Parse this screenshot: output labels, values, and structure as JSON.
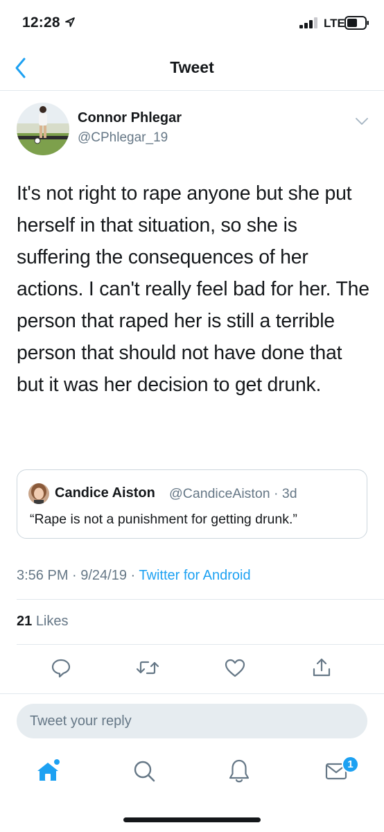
{
  "status_bar": {
    "time": "12:28",
    "network": "LTE",
    "icons": [
      "location-arrow-icon",
      "signal-icon",
      "battery-icon"
    ]
  },
  "nav": {
    "title": "Tweet",
    "back_icon": "chevron-left-icon"
  },
  "tweet": {
    "author_name": "Connor Phlegar",
    "author_handle": "@CPhlegar_19",
    "text": "It's not right to rape anyone but she put herself in that situation, so she is suffering the consequences of her actions. I can't really feel bad for her. The person that raped her is still a terrible person that should not have done that but it was her decision to get drunk.",
    "quoted": {
      "name": "Candice Aiston",
      "handle": "@CandiceAiston",
      "age": "3d",
      "meta": "@CandiceAiston · 3d",
      "text": "“Rape is not a punishment for getting drunk.”"
    },
    "timestamp": "3:56 PM · 9/24/19 · ",
    "source": "Twitter for Android",
    "likes_count": "21",
    "likes_label": "Likes"
  },
  "actions": [
    "reply-icon",
    "retweet-icon",
    "like-icon",
    "share-icon"
  ],
  "reply": {
    "placeholder": "Tweet your reply"
  },
  "tab_bar": {
    "tabs": [
      "home-icon",
      "search-icon",
      "notifications-icon",
      "messages-icon"
    ],
    "messages_badge": "1"
  },
  "colors": {
    "accent": "#1da1f2",
    "text": "#14171a",
    "secondary": "#657786",
    "divider": "#e1e8ed",
    "reply_bg": "#e6ecf0"
  }
}
